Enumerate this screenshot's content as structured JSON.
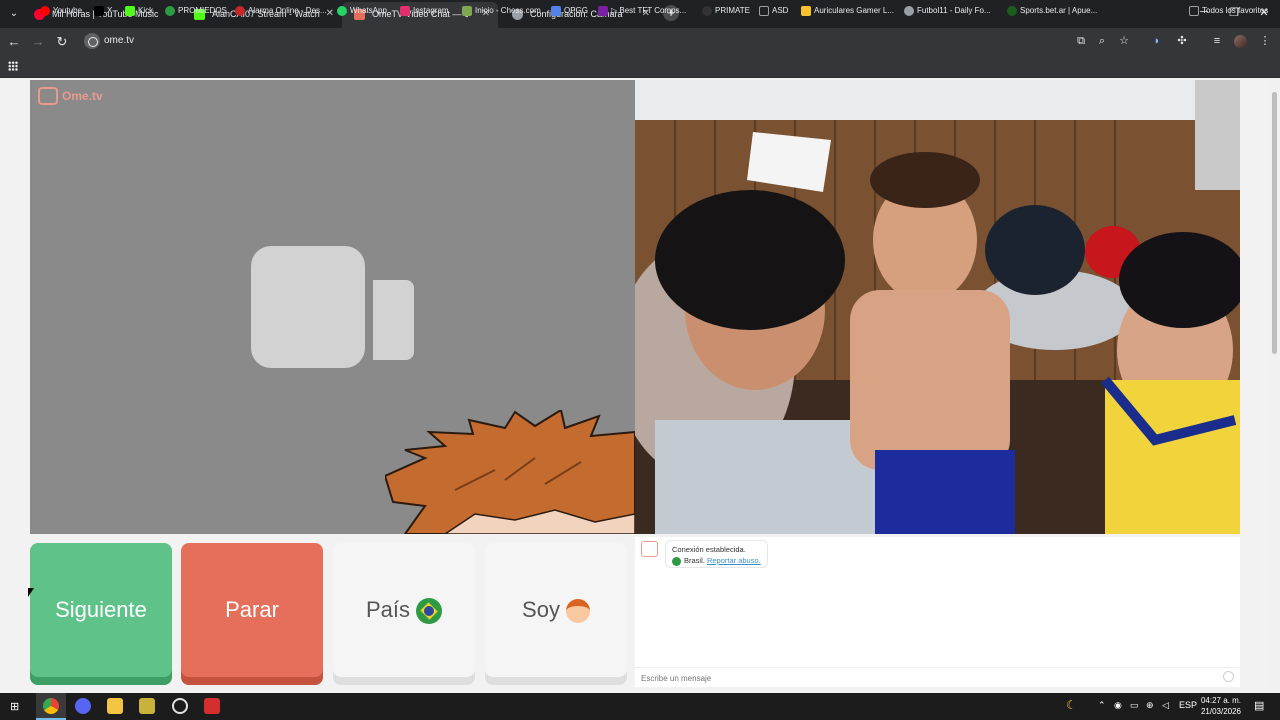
{
  "browser": {
    "tabs": [
      {
        "title": "Mil Horas | YouTube Music",
        "favicon_color": "#ff0033"
      },
      {
        "title": "AlanCAI07 Stream - Watch Live",
        "favicon_color": "#53fc18"
      },
      {
        "title": "OmeTV Video Chat — Ome",
        "favicon_color": "#e66f5c"
      },
      {
        "title": "Configuración: Cámara",
        "favicon_color": "#9aa0a6"
      }
    ],
    "url": "ome.tv",
    "bookmarks": [
      {
        "label": "Youtube",
        "color": "#ff0000"
      },
      {
        "label": "X",
        "color": "#000000"
      },
      {
        "label": "Kick",
        "color": "#53fc18"
      },
      {
        "label": "PROMIEDOS",
        "color": "#2e9b44"
      },
      {
        "label": "Alarma Online - Des...",
        "color": "#c62828"
      },
      {
        "label": "WhatsApp",
        "color": "#25d366"
      },
      {
        "label": "Instagram",
        "color": "#e1306c"
      },
      {
        "label": "Inicio - Chess.com",
        "color": "#7fa650"
      },
      {
        "label": "OPGG",
        "color": "#5383e8"
      },
      {
        "label": "▷ Best TFT Comps...",
        "color": "#7b1fa2"
      },
      {
        "label": "PRIMATE",
        "color": "#333333"
      },
      {
        "label": "ASD",
        "color": "#9aa0a6"
      },
      {
        "label": "Auriculares Gamer L...",
        "color": "#f9c12e"
      },
      {
        "label": "Futbol11 - Daily Fo...",
        "color": "#9aa0a6"
      },
      {
        "label": "Sports.bet.ar | Apue...",
        "color": "#1b5e20"
      }
    ],
    "all_bookmarks_label": "Todos los favoritos"
  },
  "page": {
    "logo_text": "Ome.tv",
    "buttons": {
      "next": "Siguiente",
      "stop": "Parar",
      "country": "País",
      "me": "Soy"
    },
    "chat": {
      "status": "Conexión establecida.",
      "country": "Brasil.",
      "report": "Reportar abuso.",
      "placeholder": "Escribe un mensaje"
    }
  },
  "taskbar": {
    "language": "ESP",
    "time": "04:27 a. m.",
    "date": "21/03/2026"
  }
}
